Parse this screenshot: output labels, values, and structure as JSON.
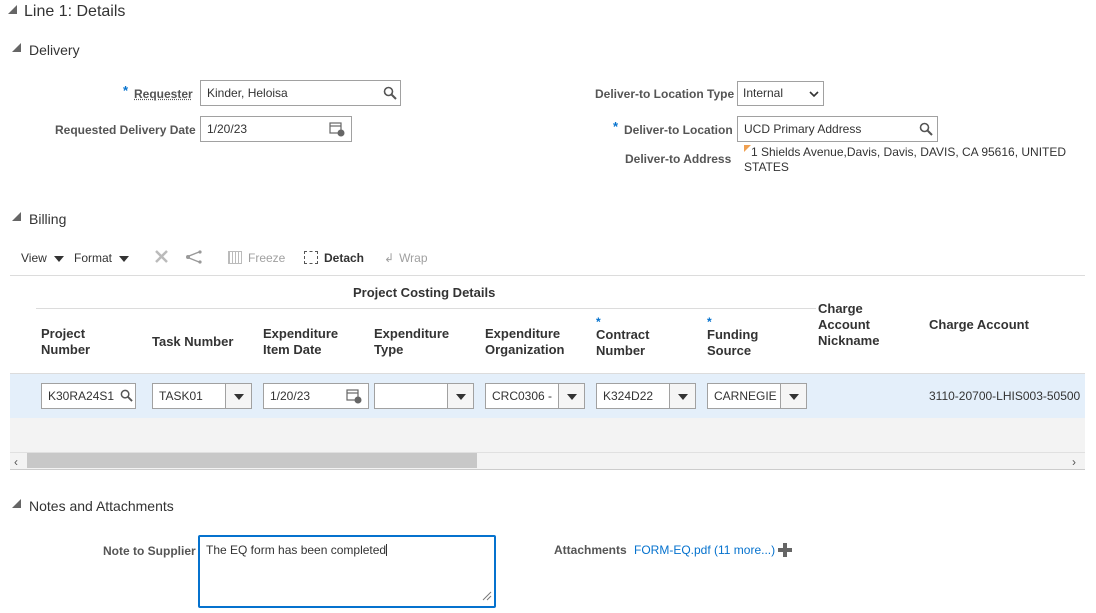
{
  "line_header": {
    "title": "Line 1: Details"
  },
  "delivery": {
    "section_title": "Delivery",
    "requester_label": "Requester",
    "requester_value": "Kinder, Heloisa",
    "requested_date_label": "Requested Delivery Date",
    "requested_date_value": "1/20/23",
    "location_type_label": "Deliver-to Location Type",
    "location_type_value": "Internal",
    "location_label": "Deliver-to Location",
    "location_value": "UCD Primary Address",
    "address_label": "Deliver-to Address",
    "address_line1": "1 Shields Avenue,Davis, Davis, DAVIS, CA 95616, UNITED",
    "address_line2": "STATES",
    "required_marker": "*"
  },
  "billing": {
    "section_title": "Billing",
    "toolbar": {
      "view": "View",
      "format": "Format",
      "freeze": "Freeze",
      "detach": "Detach",
      "wrap": "Wrap"
    },
    "group_header": "Project Costing Details",
    "columns": {
      "project_number": [
        "Project",
        "Number"
      ],
      "task_number": "Task Number",
      "exp_item_date": [
        "Expenditure",
        "Item Date"
      ],
      "exp_type": [
        "Expenditure",
        "Type"
      ],
      "exp_org": [
        "Expenditure",
        "Organization"
      ],
      "contract_number": [
        "Contract",
        "Number"
      ],
      "funding_source": [
        "Funding",
        "Source"
      ],
      "charge_nickname": [
        "Charge",
        "Account",
        "Nickname"
      ],
      "charge_account": "Charge Account"
    },
    "row": {
      "project_number": "K30RA24S1",
      "task_number": "TASK01",
      "exp_item_date": "1/20/23",
      "exp_type": "",
      "exp_org": "CRC0306 -",
      "contract_number": "K324D22",
      "funding_source": "CARNEGIE",
      "charge_account": "3110-20700-LHIS003-50500"
    }
  },
  "notes": {
    "section_title": "Notes and Attachments",
    "note_label": "Note to Supplier",
    "note_value": "The EQ form has been completed",
    "attachments_label": "Attachments",
    "attachments_link": "FORM-EQ.pdf (11 more...)"
  },
  "colors": {
    "accent": "#0572ce",
    "row_selected": "#e4effa",
    "text": "#333333"
  }
}
